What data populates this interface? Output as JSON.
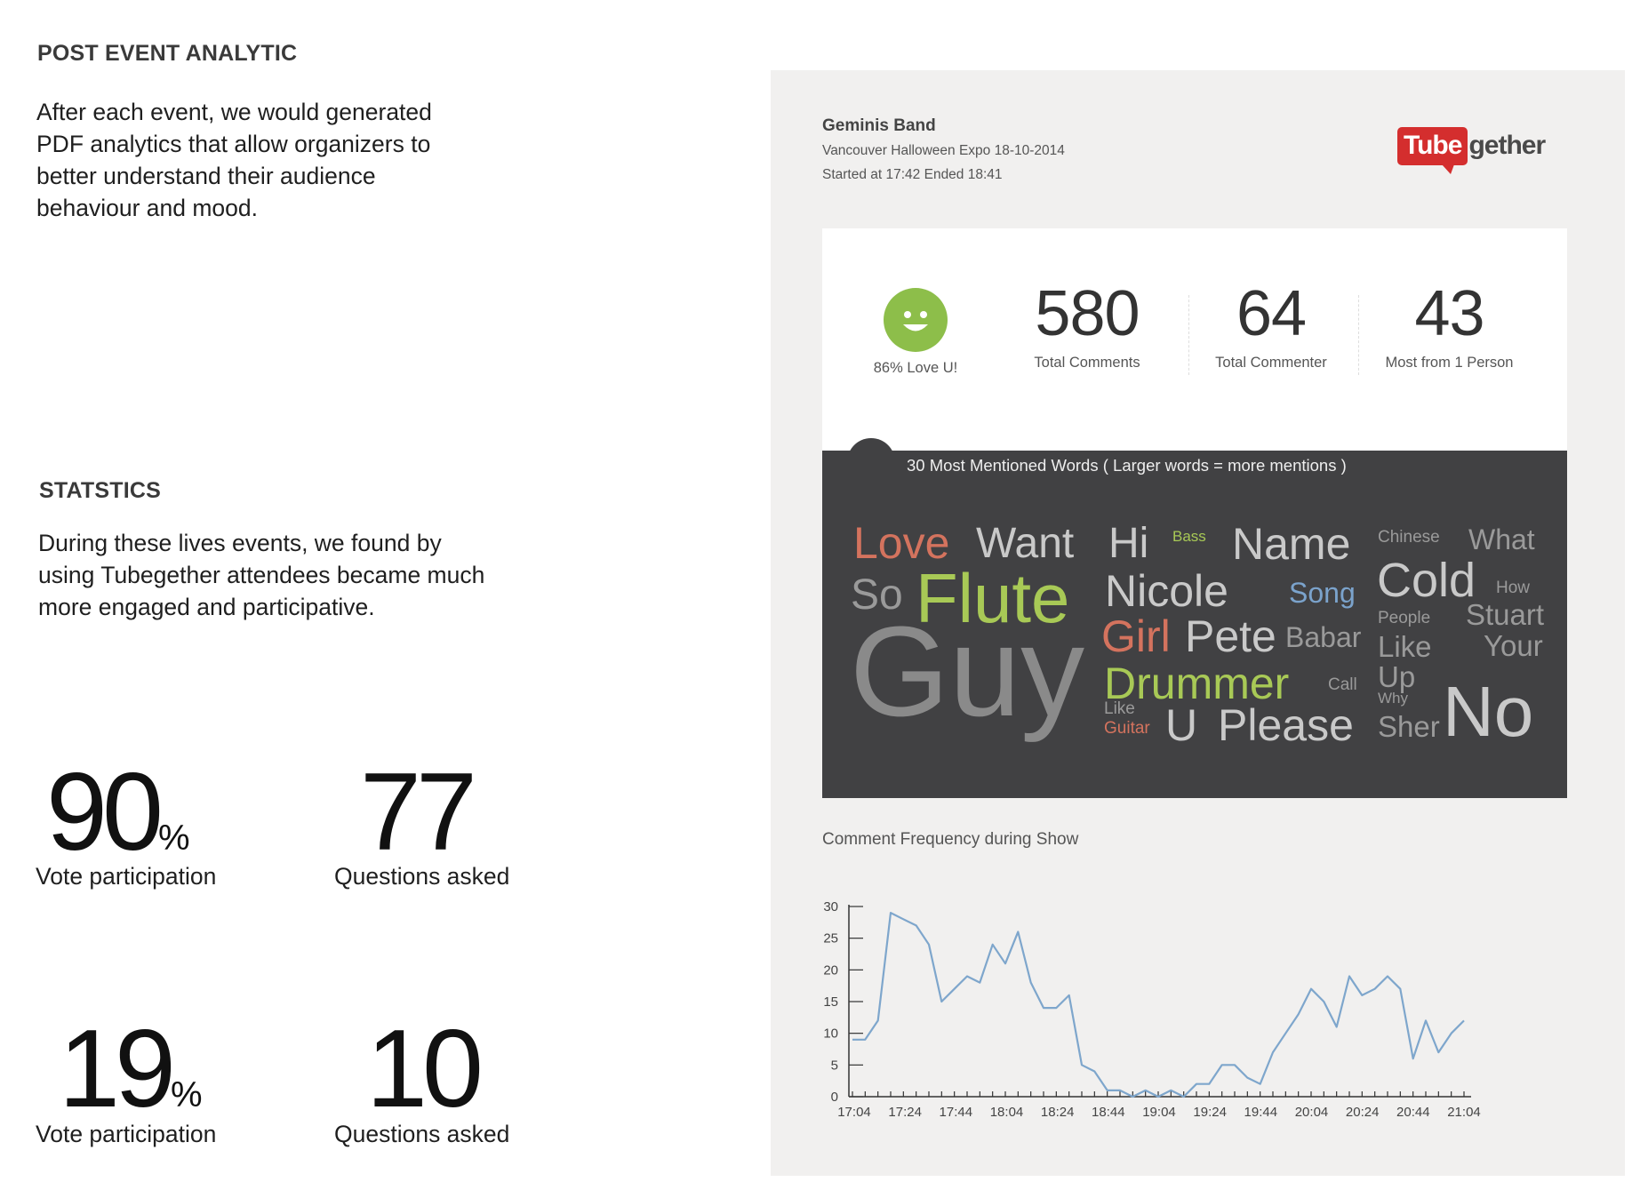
{
  "intro": {
    "heading": "POST EVENT ANALYTIC",
    "lines": [
      "After each event, we would generated",
      "PDF analytics that allow organizers to",
      "better understand their audience",
      "behaviour and mood."
    ]
  },
  "stats": {
    "heading": "STATSTICS",
    "lines": [
      "During these lives events, we found by",
      "using Tubegether attendees became much",
      "more engaged and participative."
    ],
    "items": [
      {
        "number": "90",
        "suffix": "%",
        "label": "Vote participation"
      },
      {
        "number": "77",
        "suffix": "",
        "label": "Questions asked"
      },
      {
        "number": "19",
        "suffix": "%",
        "label": "Vote participation"
      },
      {
        "number": "10",
        "suffix": "",
        "label": "Questions asked"
      }
    ]
  },
  "report": {
    "band": "Geminis Band",
    "event": "Vancouver Halloween Expo 18-10-2014",
    "times": "Started at 17:42 Ended 18:41",
    "logo": {
      "box": "Tube",
      "rest": "gether",
      "color": "#d42e2e"
    },
    "mood_label": "86% Love U!",
    "kpis": [
      {
        "value": "580",
        "label": "Total Comments"
      },
      {
        "value": "64",
        "label": "Total Commenter"
      },
      {
        "value": "43",
        "label": "Most from 1 Person"
      }
    ],
    "cloud_title": "30 Most Mentioned Words ( Larger words = more mentions )",
    "words": [
      {
        "text": "Love",
        "color": "#d4735e"
      },
      {
        "text": "Want",
        "color": "#c9c9c9"
      },
      {
        "text": "Hi",
        "color": "#c9c9c9"
      },
      {
        "text": "Bass",
        "color": "#a8c956"
      },
      {
        "text": "Name",
        "color": "#c9c9c9"
      },
      {
        "text": "Chinese",
        "color": "#9a9a9a"
      },
      {
        "text": "What",
        "color": "#9a9a9a"
      },
      {
        "text": "So",
        "color": "#9a9a9a"
      },
      {
        "text": "Flute",
        "color": "#a8c956"
      },
      {
        "text": "Nicole",
        "color": "#c9c9c9"
      },
      {
        "text": "Song",
        "color": "#7ba3cc"
      },
      {
        "text": "Cold",
        "color": "#c9c9c9"
      },
      {
        "text": "How",
        "color": "#9a9a9a"
      },
      {
        "text": "Girl",
        "color": "#d4735e"
      },
      {
        "text": "Pete",
        "color": "#c9c9c9"
      },
      {
        "text": "Babar",
        "color": "#9a9a9a"
      },
      {
        "text": "People",
        "color": "#9a9a9a"
      },
      {
        "text": "Stuart",
        "color": "#9a9a9a"
      },
      {
        "text": "Like",
        "color": "#9a9a9a"
      },
      {
        "text": "Your",
        "color": "#9a9a9a"
      },
      {
        "text": "Guy",
        "color": "#8a8a8a"
      },
      {
        "text": "Drummer",
        "color": "#a8c956"
      },
      {
        "text": "Call",
        "color": "#9a9a9a"
      },
      {
        "text": "Up",
        "color": "#9a9a9a"
      },
      {
        "text": "Why",
        "color": "#9a9a9a"
      },
      {
        "text": "No",
        "color": "#c9c9c9"
      },
      {
        "text": "Like",
        "color": "#9a9a9a"
      },
      {
        "text": "Guitar",
        "color": "#d4735e"
      },
      {
        "text": "U",
        "color": "#c9c9c9"
      },
      {
        "text": "Please",
        "color": "#c9c9c9"
      },
      {
        "text": "Sher",
        "color": "#9a9a9a"
      }
    ]
  },
  "chart_data": {
    "type": "line",
    "title": "Comment Frequency during Show",
    "xlabel": "",
    "ylabel": "",
    "ylim": [
      0,
      30
    ],
    "yticks": [
      0,
      5,
      10,
      15,
      20,
      25,
      30
    ],
    "xticks": [
      "17:04",
      "17:24",
      "17:44",
      "18:04",
      "18:24",
      "18:44",
      "19:04",
      "19:24",
      "19:44",
      "20:04",
      "20:24",
      "20:44",
      "21:04"
    ],
    "line_color": "#7ea6cc",
    "grid": false,
    "series": [
      {
        "values": [
          9,
          9,
          12,
          29,
          28,
          27,
          24,
          15,
          17,
          19,
          18,
          24,
          21,
          26,
          18,
          14,
          14,
          16,
          5,
          4,
          1,
          1,
          0,
          1,
          0,
          1,
          0,
          2,
          2,
          5,
          5,
          3,
          2,
          7,
          10,
          13,
          17,
          15,
          11,
          19,
          16,
          17,
          19,
          17,
          6,
          12,
          7,
          10,
          12
        ]
      }
    ]
  }
}
